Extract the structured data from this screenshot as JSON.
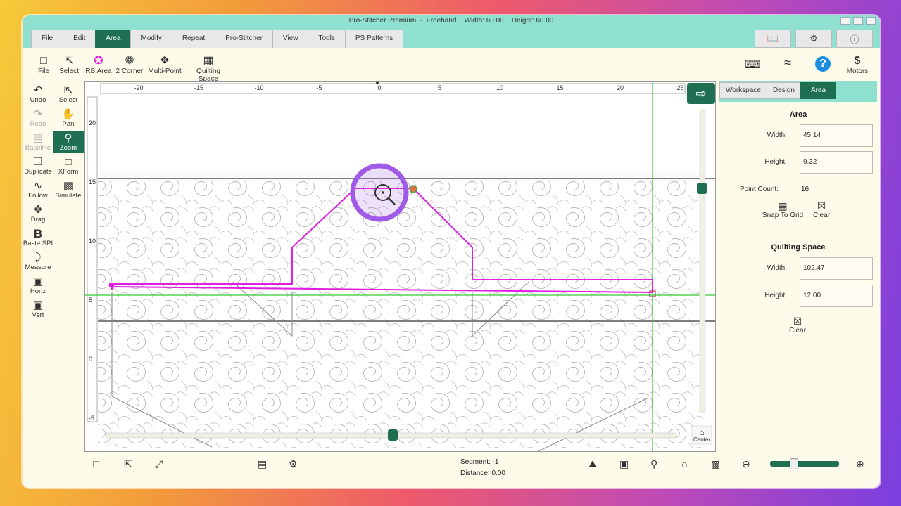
{
  "window": {
    "title": "Pro-Stitcher Premium",
    "mode": "Freehand",
    "width_label": "Width: 60.00",
    "height_label": "Height: 60.00"
  },
  "menu": {
    "tabs": [
      "File",
      "Edit",
      "Area",
      "Modify",
      "Repeat",
      "Pro-Stitcher",
      "View",
      "Tools",
      "PS Patterns"
    ],
    "active": "Area"
  },
  "toolbar": {
    "file": "File",
    "select": "Select",
    "rb_area": "RB Area",
    "two_corner": "2 Corner",
    "multi_point": "Multi-Point",
    "quilting_space": "Quilting Space",
    "motors": "Motors"
  },
  "left_tools": {
    "undo": "Undo",
    "select": "Select",
    "redo": "Redo",
    "pan": "Pan",
    "baseline": "Baseline",
    "zoom": "Zoom",
    "duplicate": "Duplicate",
    "xform": "XForm",
    "follow": "Follow",
    "simulate": "Simulate",
    "drag": "Drag",
    "baste_spi": "Baste SPI",
    "measure": "Measure",
    "horiz": "Horiz",
    "vert": "Vert"
  },
  "ruler": {
    "x_ticks": [
      "-20",
      "-15",
      "-10",
      "-5",
      "0",
      "5",
      "10",
      "15",
      "20",
      "25"
    ],
    "y_ticks": [
      "20",
      "15",
      "10",
      "5",
      "0",
      "-5"
    ]
  },
  "canvas": {
    "center_label": "Center",
    "magenta": "#e020e0",
    "green": "#33cc33",
    "zoom_ring": "#a05ae8"
  },
  "right_panel": {
    "tabs": [
      "Workspace",
      "Design",
      "Area"
    ],
    "active_tab": "Area",
    "area": {
      "title": "Area",
      "width_label": "Width:",
      "width_value": "45.14",
      "height_label": "Height:",
      "height_value": "9.32",
      "point_count_label": "Point Count:",
      "point_count_value": "16",
      "snap_to_grid": "Snap To Grid",
      "clear": "Clear"
    },
    "quilting_space": {
      "title": "Quilting Space",
      "width_label": "Width:",
      "width_value": "102.47",
      "height_label": "Height:",
      "height_value": "12.00",
      "clear": "Clear"
    }
  },
  "status": {
    "segment_label": "Segment:",
    "segment_value": "-1",
    "distance_label": "Distance:",
    "distance_value": "0.00",
    "zoom_slider_value": 0.35
  },
  "colors": {
    "accent": "#1f6f52",
    "header": "#8fe0cf",
    "background": "#fdfbe9"
  }
}
